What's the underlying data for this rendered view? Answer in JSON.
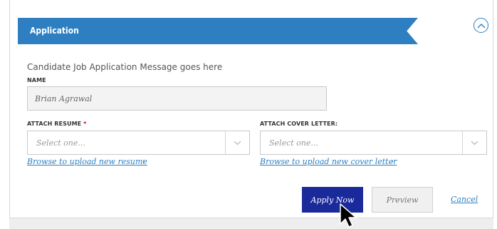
{
  "section": {
    "title": "Application",
    "collapse_icon": "chevron-up-circle-icon",
    "accent_color": "#2d7fc1"
  },
  "form": {
    "message": "Candidate Job Application Message goes here",
    "name": {
      "label": "NAME",
      "value": "Brian Agrawal"
    },
    "resume": {
      "label": "ATTACH RESUME",
      "required_marker": "*",
      "selected": "Select one...",
      "browse_link": "Browse to upload new resume",
      "browse_chevron": "›"
    },
    "cover_letter": {
      "label": "ATTACH COVER LETTER:",
      "selected": "Select one...",
      "browse_link": "Browse to upload new cover letter",
      "browse_chevron": "›"
    }
  },
  "actions": {
    "apply_label": "Apply Now",
    "apply_color": "#1a2a9a",
    "preview_label": "Preview",
    "cancel_label": "Cancel"
  }
}
